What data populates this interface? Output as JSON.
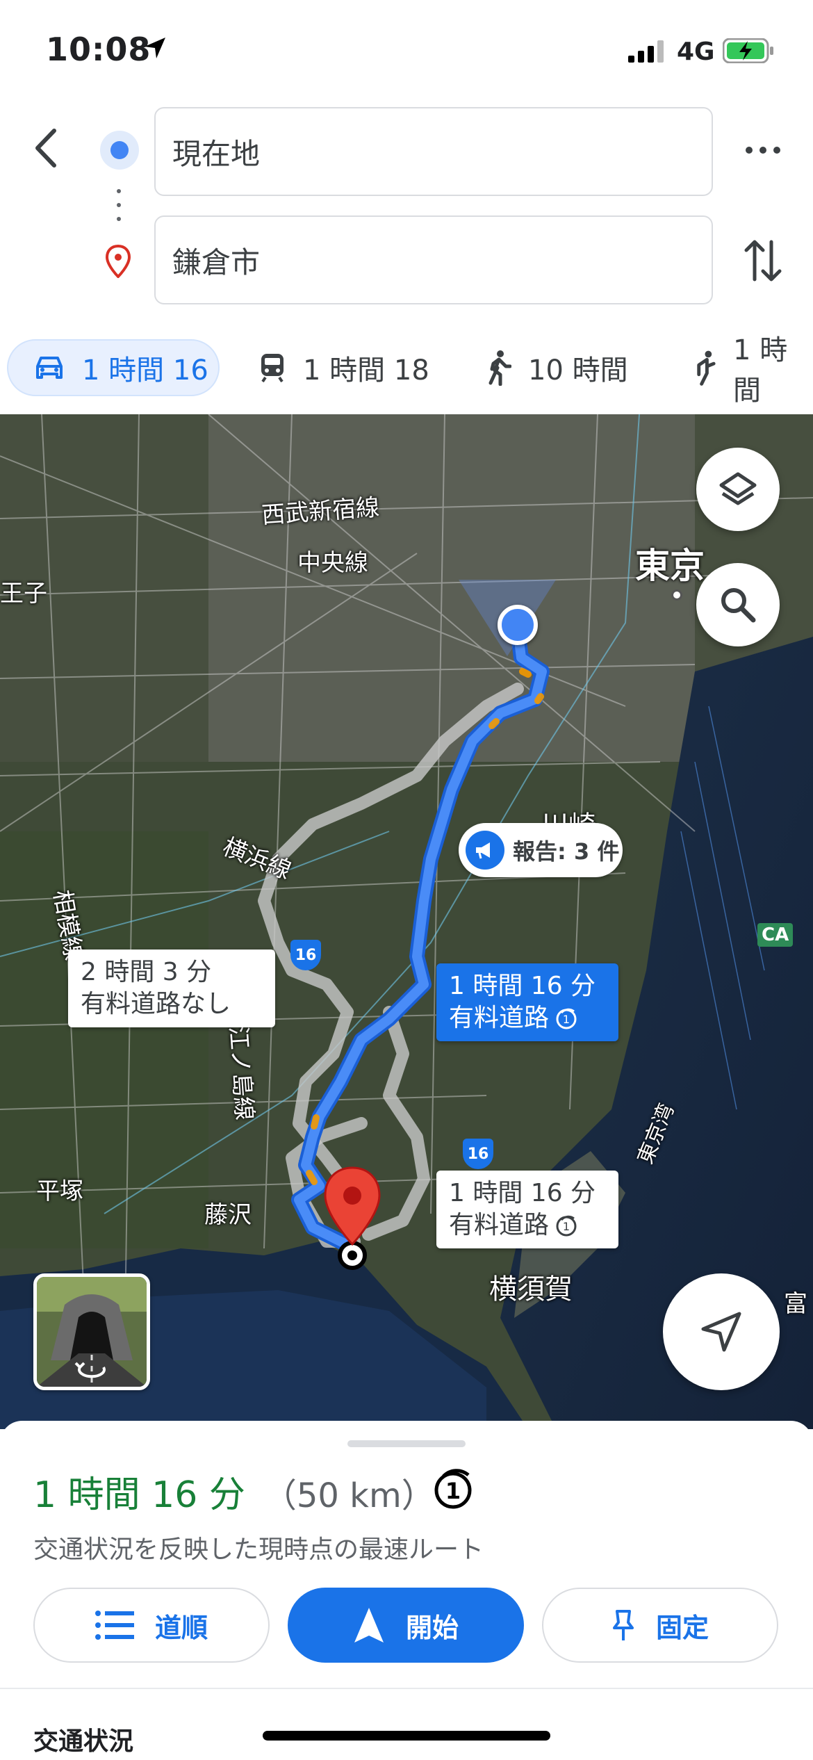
{
  "status_bar": {
    "time": "10:08",
    "network": "4G"
  },
  "search": {
    "origin": "現在地",
    "destination": "鎌倉市"
  },
  "modes": [
    {
      "label": "1 時間 16",
      "icon": "car-icon",
      "active": true
    },
    {
      "label": "1 時間 18",
      "icon": "train-icon",
      "active": false
    },
    {
      "label": "10 時間",
      "icon": "walk-icon",
      "active": false
    },
    {
      "label": "1 時間",
      "icon": "ride-icon",
      "active": false
    }
  ],
  "map": {
    "labels": {
      "seibu": "西武新宿線",
      "chuo": "中央線",
      "tokyo": "東京",
      "ouji": "王子",
      "yokohama_line": "横浜線",
      "kawasaki": "川崎",
      "sagami": "相模線",
      "enoshima": "江ノ島線",
      "hiratsuka": "平塚",
      "fujisawa": "藤沢",
      "yokosuka": "横須賀",
      "tokyo_bay": "東京湾",
      "tomi": "富"
    },
    "report": {
      "text": "報告: 3 件"
    },
    "routes": {
      "alt1": {
        "time": "2 時間 3 分",
        "note": "有料道路なし"
      },
      "main": {
        "time": "1 時間 16 分",
        "note": "有料道路"
      },
      "alt2": {
        "time": "1 時間 16 分",
        "note": "有料道路"
      }
    },
    "shields": {
      "a": "16",
      "b": "16"
    },
    "ca": "CA"
  },
  "sheet": {
    "duration": "1 時間 16 分",
    "distance": "（50 km）",
    "subtitle": "交通状況を反映した現時点の最速ルート",
    "buttons": {
      "steps": "道順",
      "start": "開始",
      "pin": "固定"
    },
    "traffic_title": "交通状況"
  },
  "colors": {
    "accent": "#1a73e8",
    "duration": "#188038",
    "route": "#4a8cf7"
  }
}
